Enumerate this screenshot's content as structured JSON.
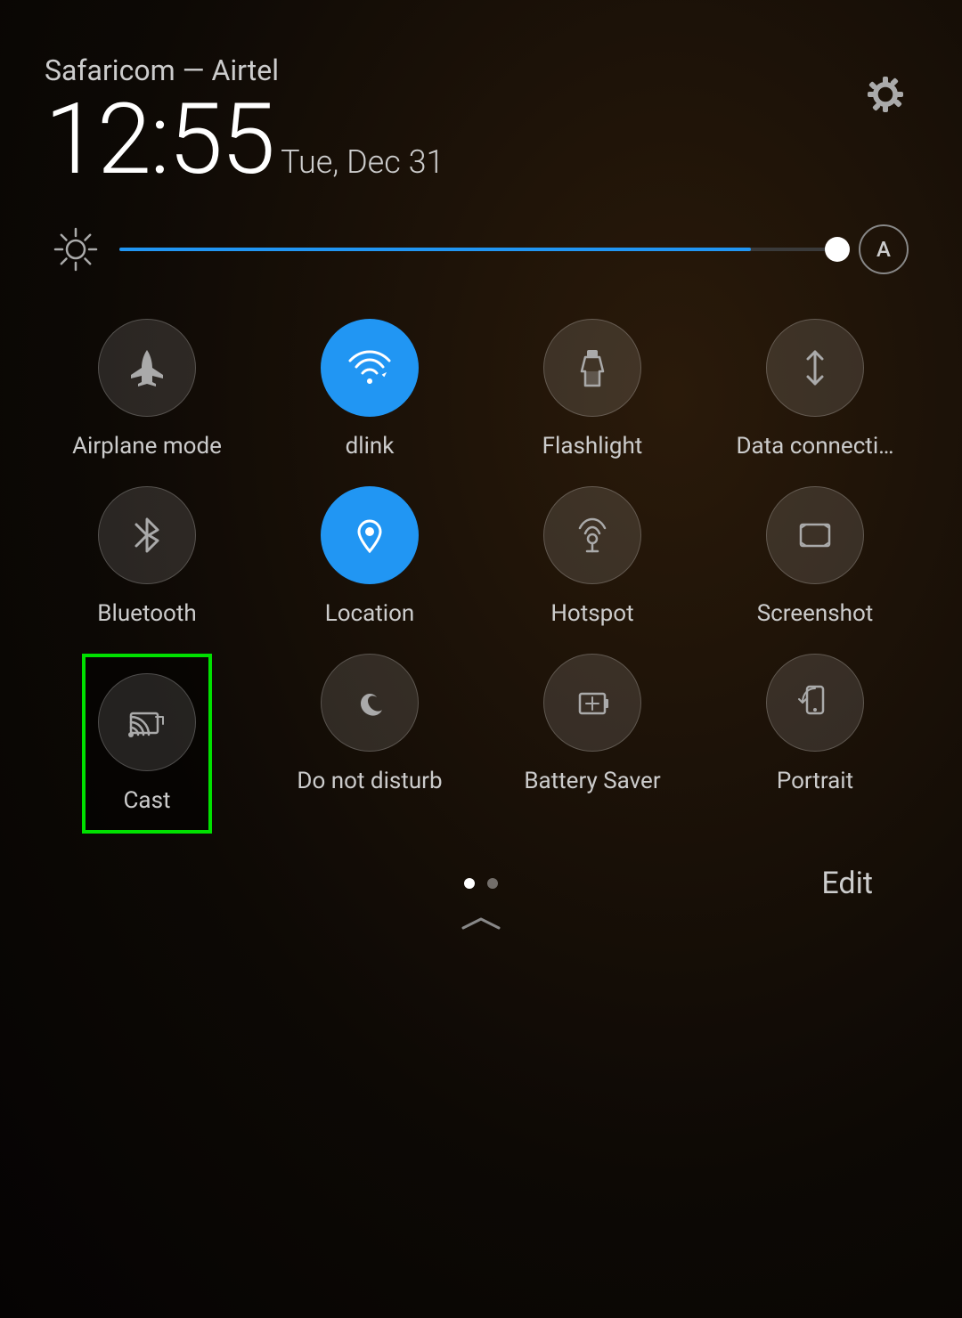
{
  "header": {
    "carrier": "Safaricom — Airtel",
    "time": "12:55",
    "date": "Tue, Dec 31"
  },
  "brightness": {
    "level": 88,
    "auto_label": "A"
  },
  "row1": [
    {
      "id": "airplane",
      "label": "Airplane mode",
      "active": false
    },
    {
      "id": "wifi",
      "label": "dlink",
      "active": true
    },
    {
      "id": "flashlight",
      "label": "Flashlight",
      "active": false
    },
    {
      "id": "data",
      "label": "Data connecti…",
      "active": false
    }
  ],
  "row2": [
    {
      "id": "bluetooth",
      "label": "Bluetooth",
      "active": false
    },
    {
      "id": "location",
      "label": "Location",
      "active": true
    },
    {
      "id": "hotspot",
      "label": "Hotspot",
      "active": false
    },
    {
      "id": "screenshot",
      "label": "Screenshot",
      "active": false
    }
  ],
  "row3": [
    {
      "id": "cast",
      "label": "Cast",
      "active": false,
      "highlighted": true
    },
    {
      "id": "dnd",
      "label": "Do not disturb",
      "active": false
    },
    {
      "id": "battery",
      "label": "Battery Saver",
      "active": false
    },
    {
      "id": "portrait",
      "label": "Portrait",
      "active": false
    }
  ],
  "bottom": {
    "edit_label": "Edit",
    "dots": [
      {
        "active": true
      },
      {
        "active": false
      }
    ]
  }
}
